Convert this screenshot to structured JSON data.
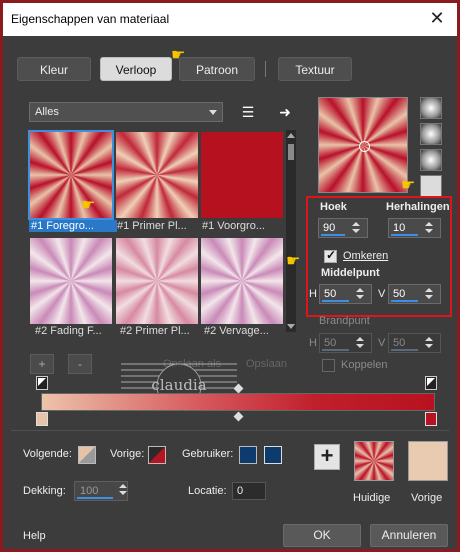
{
  "window": {
    "title": "Eigenschappen van materiaal",
    "close_label": "✕"
  },
  "tabs": [
    {
      "label": "Kleur"
    },
    {
      "label": "Verloop"
    },
    {
      "label": "Patroon"
    },
    {
      "label": "Textuur"
    }
  ],
  "filter": {
    "selected": "Alles"
  },
  "gradients": [
    {
      "label": "#1 Foregro..."
    },
    {
      "label": "#1 Primer Pl..."
    },
    {
      "label": "#1 Voorgro..."
    },
    {
      "label": "#2 Fading F..."
    },
    {
      "label": "#2 Primer Pl..."
    },
    {
      "label": "#2 Vervage..."
    }
  ],
  "settings": {
    "angle_label": "Hoek",
    "angle_value": "90",
    "repeats_label": "Herhalingen",
    "repeats_value": "10",
    "invert_label": "Omkeren",
    "center_label": "Middelpunt",
    "h_label": "H",
    "v_label": "V",
    "center_h": "50",
    "center_v": "50",
    "focus_label": "Brandpunt",
    "focus_h": "50",
    "focus_v": "50",
    "link_label": "Koppelen"
  },
  "editor": {
    "add": "+",
    "remove": "-",
    "save_as": "Opslaan als",
    "save": "Opslaan"
  },
  "watermark": {
    "name": "claudia",
    "sub": "tutorials"
  },
  "bottom": {
    "next_label": "Volgende:",
    "prev_label": "Vorige:",
    "user_label": "Gebruiker:",
    "opacity_label": "Dekking:",
    "opacity_value": "100",
    "location_label": "Locatie:",
    "location_value": "0",
    "current_label": "Huidige",
    "previous_label": "Vorige"
  },
  "footer": {
    "help": "Help",
    "ok": "OK",
    "cancel": "Annuleren"
  },
  "colors": {
    "accent_blue": "#3d8fe0",
    "highlight_red": "#e0141c",
    "user_swatch": "#0e3b6e",
    "previous_swatch": "#e8cbb0"
  }
}
